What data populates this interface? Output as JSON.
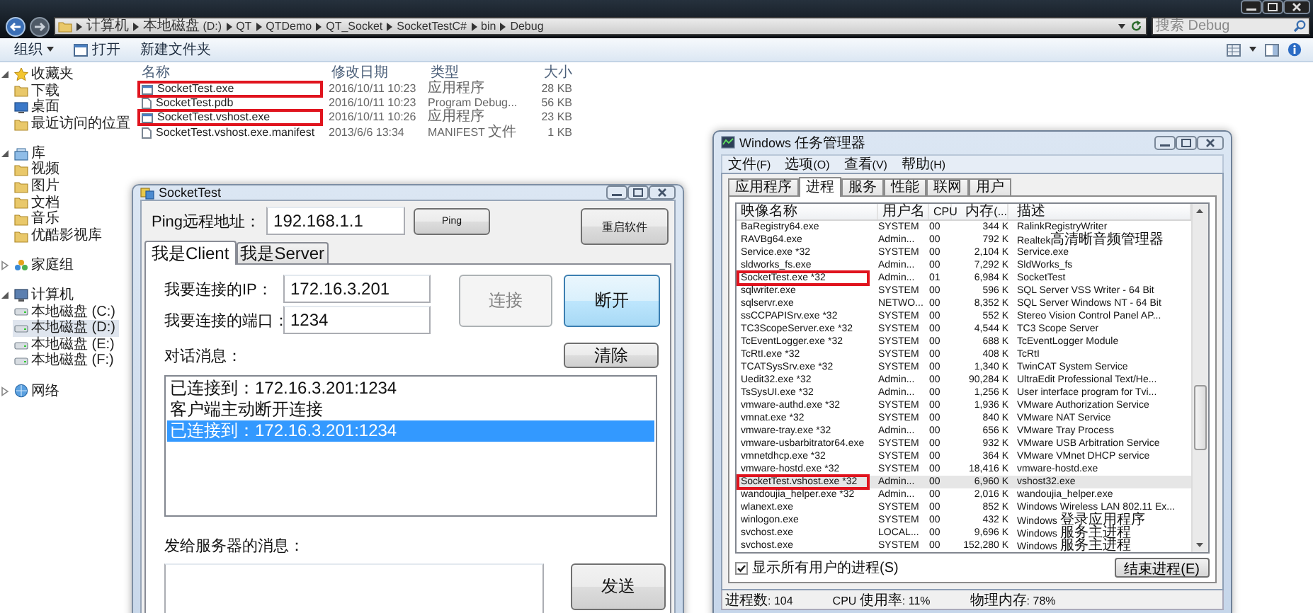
{
  "explorer": {
    "address_bar": {
      "crumbs": [
        "计算机",
        "本地磁盘 (D:)",
        "QT",
        "QTDemo",
        "QT_Socket",
        "SocketTestC#",
        "bin",
        "Debug"
      ]
    },
    "search": {
      "placeholder": "搜索 Debug"
    },
    "toolbar": [
      {
        "label": "组织",
        "kind": "menu"
      },
      {
        "label": "打开",
        "kind": "open"
      },
      {
        "label": "新建文件夹",
        "kind": "plain"
      }
    ],
    "sidebar": [
      {
        "label": "收藏夹",
        "kind": "star",
        "expanded": true,
        "selected": false,
        "children": [
          {
            "label": "下载",
            "kind": "folder",
            "selected": false
          },
          {
            "label": "桌面",
            "kind": "desktop",
            "selected": false
          },
          {
            "label": "最近访问的位置",
            "kind": "folder",
            "selected": false
          }
        ]
      },
      {
        "label": "库",
        "kind": "library",
        "expanded": true,
        "selected": false,
        "children": [
          {
            "label": "视频",
            "kind": "folder",
            "selected": false
          },
          {
            "label": "图片",
            "kind": "folder",
            "selected": false
          },
          {
            "label": "文档",
            "kind": "folder",
            "selected": false
          },
          {
            "label": "音乐",
            "kind": "folder",
            "selected": false
          },
          {
            "label": "优酷影视库",
            "kind": "folder",
            "selected": false
          }
        ]
      },
      {
        "label": "家庭组",
        "kind": "homegroup",
        "expanded": false,
        "selected": false
      },
      {
        "label": "计算机",
        "kind": "computer",
        "expanded": true,
        "selected": false,
        "children": [
          {
            "label": "本地磁盘 (C:)",
            "kind": "drive",
            "selected": false
          },
          {
            "label": "本地磁盘 (D:)",
            "kind": "drive",
            "selected": true
          },
          {
            "label": "本地磁盘 (E:)",
            "kind": "drive",
            "selected": false
          },
          {
            "label": "本地磁盘 (F:)",
            "kind": "drive",
            "selected": false
          }
        ]
      },
      {
        "label": "网络",
        "kind": "network",
        "expanded": false,
        "selected": false
      }
    ],
    "file_list": {
      "columns": [
        "名称",
        "修改日期",
        "类型",
        "大小"
      ],
      "rows": [
        {
          "name": "SocketTest.exe",
          "kind": "exe",
          "modified": "2016/10/11 10:23",
          "type": "应用程序",
          "size": "28 KB",
          "highlighted": true
        },
        {
          "name": "SocketTest.pdb",
          "kind": "file",
          "modified": "2016/10/11 10:23",
          "type": "Program Debug...",
          "size": "56 KB",
          "highlighted": false
        },
        {
          "name": "SocketTest.vshost.exe",
          "kind": "exe",
          "modified": "2016/10/11 10:26",
          "type": "应用程序",
          "size": "23 KB",
          "highlighted": true
        },
        {
          "name": "SocketTest.vshost.exe.manifest",
          "kind": "file",
          "modified": "2013/6/6 13:34",
          "type": "MANIFEST 文件",
          "size": "1 KB",
          "highlighted": false
        }
      ]
    }
  },
  "socket_test": {
    "title": "SocketTest",
    "ping_label": "Ping远程地址：",
    "ping_address": "192.168.1.1",
    "ping_button": "Ping",
    "restart_button": "重启软件",
    "tabs": [
      {
        "label": "我是Client",
        "selected": true
      },
      {
        "label": "我是Server",
        "selected": false
      }
    ],
    "ip_label": "我要连接的IP：",
    "ip_value": "172.16.3.201",
    "port_label": "我要连接的端口：",
    "port_value": "1234",
    "connect_button": {
      "label": "连接",
      "disabled": true,
      "focused": false
    },
    "disconnect_button": {
      "label": "断开",
      "disabled": false,
      "focused": true
    },
    "messages_label": "对话消息：",
    "clear_button": "清除",
    "messages": [
      {
        "text": "已连接到：172.16.3.201:1234",
        "selected": false
      },
      {
        "text": "客户端主动断开连接",
        "selected": false
      },
      {
        "text": "已连接到：172.16.3.201:1234",
        "selected": true
      }
    ],
    "send_label": "发给服务器的消息：",
    "send_button": "发送"
  },
  "task_manager": {
    "title": "Windows 任务管理器",
    "menu": [
      "文件(F)",
      "选项(O)",
      "查看(V)",
      "帮助(H)"
    ],
    "tabs": [
      {
        "label": "应用程序",
        "selected": false
      },
      {
        "label": "进程",
        "selected": true
      },
      {
        "label": "服务",
        "selected": false
      },
      {
        "label": "性能",
        "selected": false
      },
      {
        "label": "联网",
        "selected": false
      },
      {
        "label": "用户",
        "selected": false
      }
    ],
    "columns": [
      "映像名称",
      "用户名",
      "CPU",
      "内存(...",
      "描述"
    ],
    "rows": [
      {
        "image": "BaRegistry64.exe",
        "user": "SYSTEM",
        "cpu": "00",
        "memory": "344 K",
        "description": "RalinkRegistryWriter",
        "highlighted": false,
        "selected": false
      },
      {
        "image": "RAVBg64.exe",
        "user": "Admin...",
        "cpu": "00",
        "memory": "792 K",
        "description": "Realtek高清晰音频管理器",
        "highlighted": false,
        "selected": false
      },
      {
        "image": "Service.exe *32",
        "user": "SYSTEM",
        "cpu": "00",
        "memory": "2,104 K",
        "description": "Service.exe",
        "highlighted": false,
        "selected": false
      },
      {
        "image": "sldworks_fs.exe",
        "user": "Admin...",
        "cpu": "00",
        "memory": "7,292 K",
        "description": "SldWorks_fs",
        "highlighted": false,
        "selected": false
      },
      {
        "image": "SocketTest.exe *32",
        "user": "Admin...",
        "cpu": "01",
        "memory": "6,984 K",
        "description": "SocketTest",
        "highlighted": true,
        "selected": false
      },
      {
        "image": "sqlwriter.exe",
        "user": "SYSTEM",
        "cpu": "00",
        "memory": "596 K",
        "description": "SQL Server VSS Writer - 64 Bit",
        "highlighted": false,
        "selected": false
      },
      {
        "image": "sqlservr.exe",
        "user": "NETWO...",
        "cpu": "00",
        "memory": "8,352 K",
        "description": "SQL Server Windows NT - 64 Bit",
        "highlighted": false,
        "selected": false
      },
      {
        "image": "ssCCPAPISrv.exe *32",
        "user": "SYSTEM",
        "cpu": "00",
        "memory": "552 K",
        "description": "Stereo Vision Control Panel AP...",
        "highlighted": false,
        "selected": false
      },
      {
        "image": "TC3ScopeServer.exe *32",
        "user": "SYSTEM",
        "cpu": "00",
        "memory": "4,544 K",
        "description": "TC3 Scope Server",
        "highlighted": false,
        "selected": false
      },
      {
        "image": "TcEventLogger.exe *32",
        "user": "SYSTEM",
        "cpu": "00",
        "memory": "688 K",
        "description": "TcEventLogger Module",
        "highlighted": false,
        "selected": false
      },
      {
        "image": "TcRtI.exe *32",
        "user": "SYSTEM",
        "cpu": "00",
        "memory": "408 K",
        "description": "TcRtI",
        "highlighted": false,
        "selected": false
      },
      {
        "image": "TCATSysSrv.exe *32",
        "user": "SYSTEM",
        "cpu": "00",
        "memory": "1,340 K",
        "description": "TwinCAT System Service",
        "highlighted": false,
        "selected": false
      },
      {
        "image": "Uedit32.exe *32",
        "user": "Admin...",
        "cpu": "00",
        "memory": "90,284 K",
        "description": "UltraEdit Professional Text/He...",
        "highlighted": false,
        "selected": false
      },
      {
        "image": "TsSysUI.exe *32",
        "user": "Admin...",
        "cpu": "00",
        "memory": "1,256 K",
        "description": "User interface program for Tvi...",
        "highlighted": false,
        "selected": false
      },
      {
        "image": "vmware-authd.exe *32",
        "user": "SYSTEM",
        "cpu": "00",
        "memory": "1,936 K",
        "description": "VMware Authorization Service",
        "highlighted": false,
        "selected": false
      },
      {
        "image": "vmnat.exe *32",
        "user": "SYSTEM",
        "cpu": "00",
        "memory": "840 K",
        "description": "VMware NAT Service",
        "highlighted": false,
        "selected": false
      },
      {
        "image": "vmware-tray.exe *32",
        "user": "Admin...",
        "cpu": "00",
        "memory": "656 K",
        "description": "VMware Tray Process",
        "highlighted": false,
        "selected": false
      },
      {
        "image": "vmware-usbarbitrator64.exe",
        "user": "SYSTEM",
        "cpu": "00",
        "memory": "932 K",
        "description": "VMware USB Arbitration Service",
        "highlighted": false,
        "selected": false
      },
      {
        "image": "vmnetdhcp.exe *32",
        "user": "SYSTEM",
        "cpu": "00",
        "memory": "364 K",
        "description": "VMware VMnet DHCP service",
        "highlighted": false,
        "selected": false
      },
      {
        "image": "vmware-hostd.exe *32",
        "user": "SYSTEM",
        "cpu": "00",
        "memory": "18,416 K",
        "description": "vmware-hostd.exe",
        "highlighted": false,
        "selected": false
      },
      {
        "image": "SocketTest.vshost.exe *32",
        "user": "Admin...",
        "cpu": "00",
        "memory": "6,960 K",
        "description": "vshost32.exe",
        "highlighted": true,
        "selected": true
      },
      {
        "image": "wandoujia_helper.exe *32",
        "user": "Admin...",
        "cpu": "00",
        "memory": "2,016 K",
        "description": "wandoujia_helper.exe",
        "highlighted": false,
        "selected": false
      },
      {
        "image": "wlanext.exe",
        "user": "SYSTEM",
        "cpu": "00",
        "memory": "852 K",
        "description": "Windows Wireless LAN 802.11 Ex...",
        "highlighted": false,
        "selected": false
      },
      {
        "image": "winlogon.exe",
        "user": "SYSTEM",
        "cpu": "00",
        "memory": "432 K",
        "description": "Windows 登录应用程序",
        "highlighted": false,
        "selected": false
      },
      {
        "image": "svchost.exe",
        "user": "LOCAL...",
        "cpu": "00",
        "memory": "9,696 K",
        "description": "Windows 服务主进程",
        "highlighted": false,
        "selected": false
      },
      {
        "image": "svchost.exe",
        "user": "SYSTEM",
        "cpu": "00",
        "memory": "152,280 K",
        "description": "Windows 服务主进程",
        "highlighted": false,
        "selected": false
      }
    ],
    "show_all": {
      "label": "显示所有用户的进程(S)",
      "checked": true
    },
    "end_button": "结束进程(E)",
    "status": [
      "进程数: 104",
      "CPU 使用率: 11%",
      "物理内存: 78%"
    ]
  }
}
